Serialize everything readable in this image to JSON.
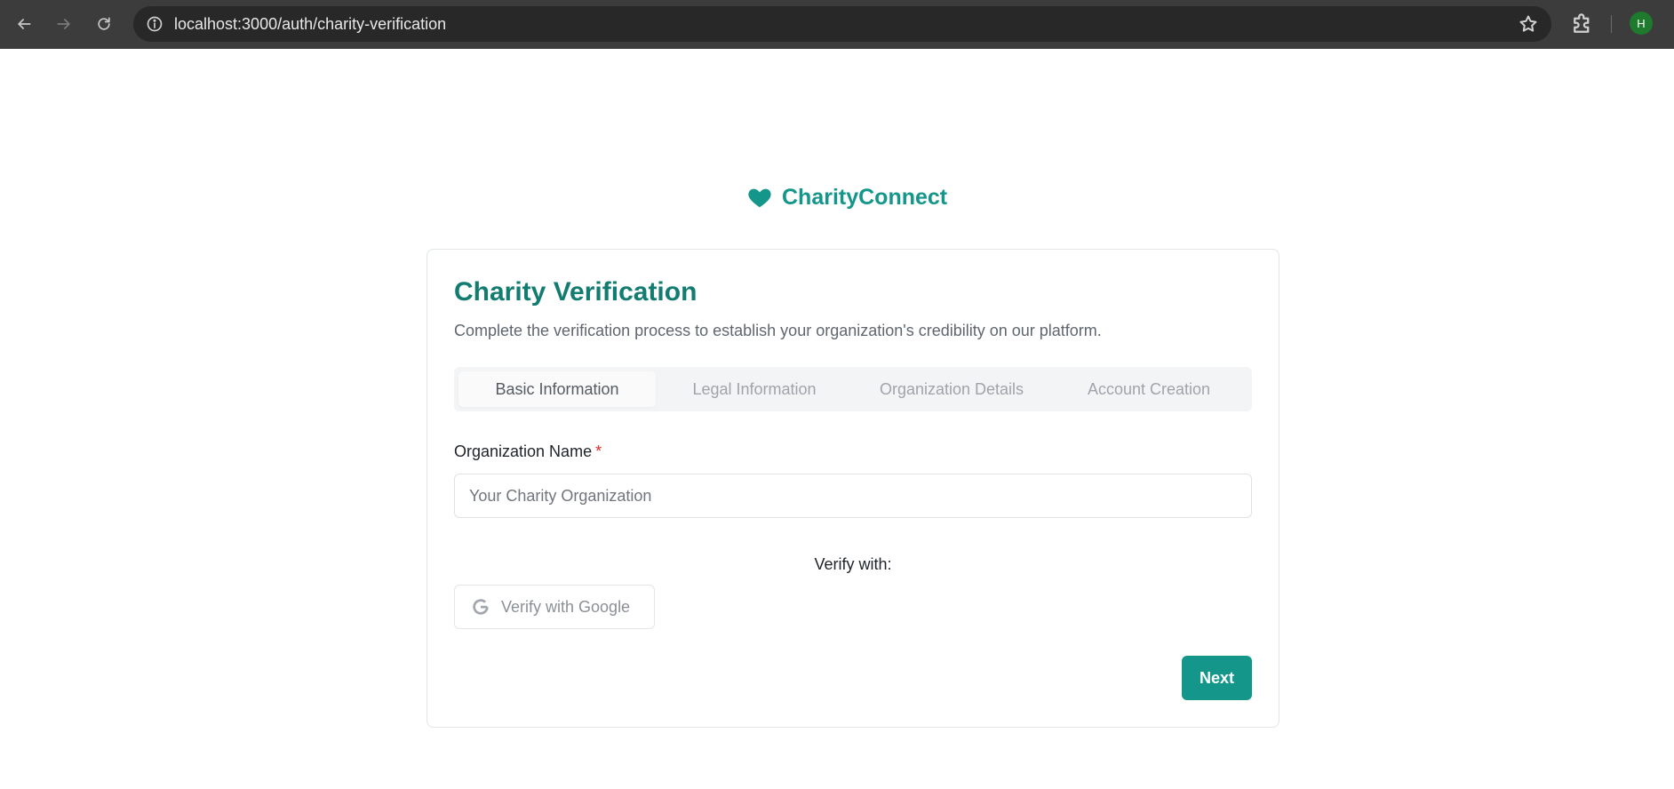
{
  "browser": {
    "url": "localhost:3000/auth/charity-verification",
    "profile_initial": "H"
  },
  "brand": {
    "name": "CharityConnect",
    "color": "#14968a"
  },
  "card": {
    "title": "Charity Verification",
    "subtitle": "Complete the verification process to establish your organization's credibility on our platform.",
    "tabs": [
      {
        "label": "Basic Information",
        "active": true
      },
      {
        "label": "Legal Information",
        "active": false
      },
      {
        "label": "Organization Details",
        "active": false
      },
      {
        "label": "Account Creation",
        "active": false
      }
    ],
    "org_name": {
      "label": "Organization Name",
      "required_mark": "*",
      "placeholder": "Your Charity Organization",
      "value": ""
    },
    "verify_with_label": "Verify with:",
    "google_button_label": "Verify with Google",
    "next_button_label": "Next"
  },
  "icons": {
    "back": "arrow-left-icon",
    "forward": "arrow-right-icon",
    "reload": "reload-icon",
    "site_info": "info-icon",
    "bookmark": "star-icon",
    "extensions": "puzzle-icon",
    "brand": "heart-icon",
    "google": "google-g-icon"
  },
  "colors": {
    "accent": "#14968a",
    "title": "#127c70",
    "required": "#e02b2b"
  }
}
